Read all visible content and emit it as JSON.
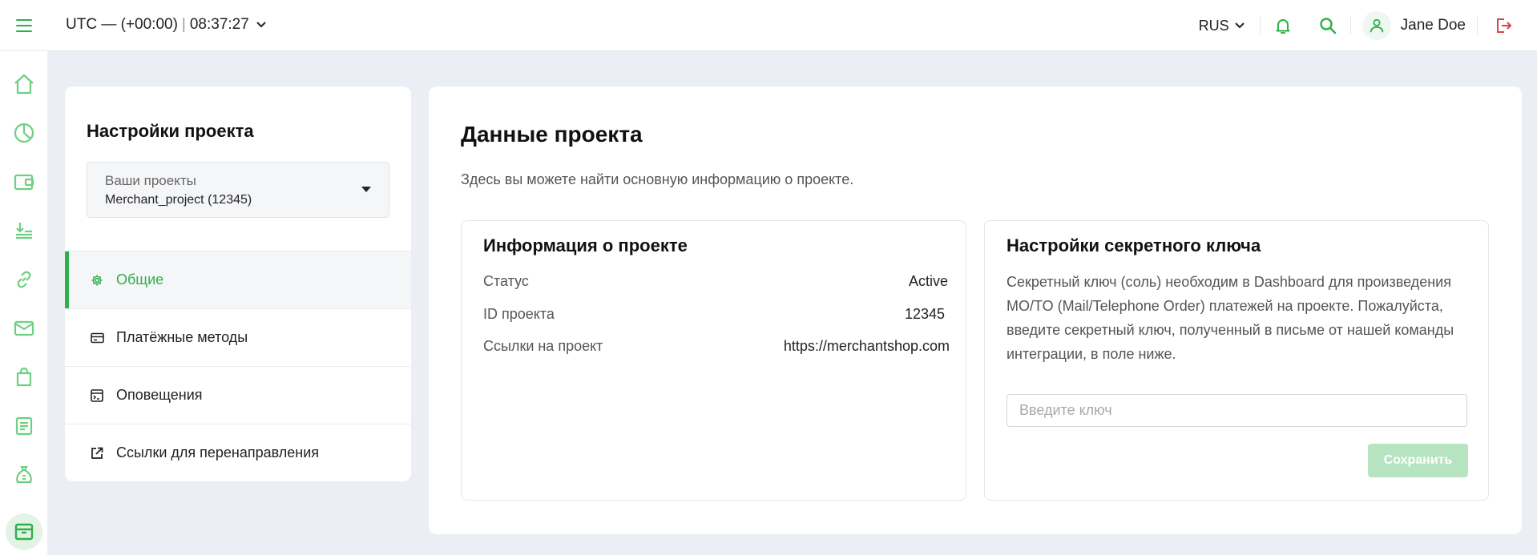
{
  "header": {
    "timezone": "UTC — (+00:00)",
    "time": "08:37:27",
    "language": "RUS",
    "user_name": "Jane Doe"
  },
  "colors": {
    "accent": "#2db14a",
    "logout": "#d9434c",
    "background": "#ebeef4"
  },
  "sidebar_icons": [
    "home-icon",
    "pie-chart-icon",
    "wallet-icon",
    "payouts-icon",
    "link-icon",
    "mail-icon",
    "bag-icon",
    "document-icon",
    "money-bag-icon",
    "archive-icon"
  ],
  "project_settings": {
    "title": "Настройки проекта",
    "select_label": "Ваши проекты",
    "select_value": "Merchant_project (12345)",
    "menu": [
      {
        "label": "Общие",
        "icon": "gear-icon",
        "active": true
      },
      {
        "label": "Платёжные методы",
        "icon": "card-icon",
        "active": false
      },
      {
        "label": "Оповещения",
        "icon": "terminal-icon",
        "active": false
      },
      {
        "label": "Ссылки для перенаправления",
        "icon": "external-link-icon",
        "active": false
      }
    ]
  },
  "main": {
    "title": "Данные проекта",
    "description": "Здесь вы можете найти основную информацию о проекте.",
    "info": {
      "title": "Информация о проекте",
      "rows": [
        {
          "label": "Статус",
          "value": "Active"
        },
        {
          "label": "ID проекта",
          "value": "12345"
        },
        {
          "label": "Ссылки на проект",
          "value": "https://merchantshop.com"
        }
      ]
    },
    "secret_key": {
      "title": "Настройки секретного ключа",
      "description": "Секретный ключ (соль) необходим в Dashboard для произведения MO/TO (Mail/Telephone Order) платежей на проекте. Пожалуйста, введите секретный ключ, полученный в письме от нашей команды интеграции, в поле ниже.",
      "input_placeholder": "Введите ключ",
      "input_value": "",
      "save_label": "Сохранить"
    }
  }
}
